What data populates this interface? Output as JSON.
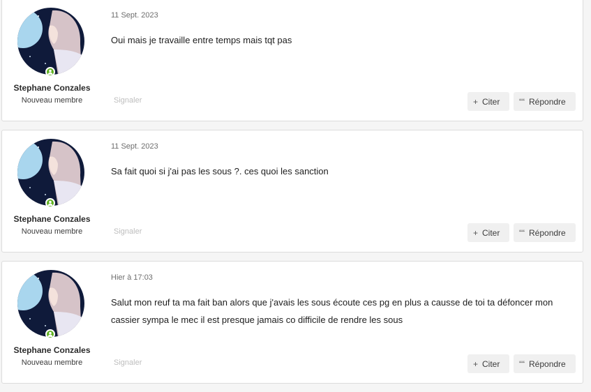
{
  "posts": [
    {
      "author": "Stephane Conzales",
      "user_title": "Nouveau membre",
      "date": "11 Sept. 2023",
      "body": "Oui mais je travaille entre temps mais tqt pas",
      "report_label": "Signaler",
      "quote_label": "Citer",
      "reply_label": "Répondre"
    },
    {
      "author": "Stephane Conzales",
      "user_title": "Nouveau membre",
      "date": "11 Sept. 2023",
      "body": "Sa fait quoi si j'ai pas les sous ?. ces quoi les sanction",
      "report_label": "Signaler",
      "quote_label": "Citer",
      "reply_label": "Répondre"
    },
    {
      "author": "Stephane Conzales",
      "user_title": "Nouveau membre",
      "date": "Hier à 17:03",
      "body": "Salut mon reuf ta ma fait ban alors que j'avais les sous écoute ces pg en plus a causse de toi ta défoncer mon cassier sympa le mec il est presque jamais co difficile de rendre les sous",
      "report_label": "Signaler",
      "quote_label": "Citer",
      "reply_label": "Répondre"
    }
  ],
  "colors": {
    "online_indicator": "#5fb01f",
    "avatar_sky": "#0f1a3a",
    "avatar_hair": "#d6c3c8"
  },
  "icons": {
    "online": "user-icon",
    "quote_button": "plus-icon",
    "reply_button": "quote-mark-icon"
  }
}
